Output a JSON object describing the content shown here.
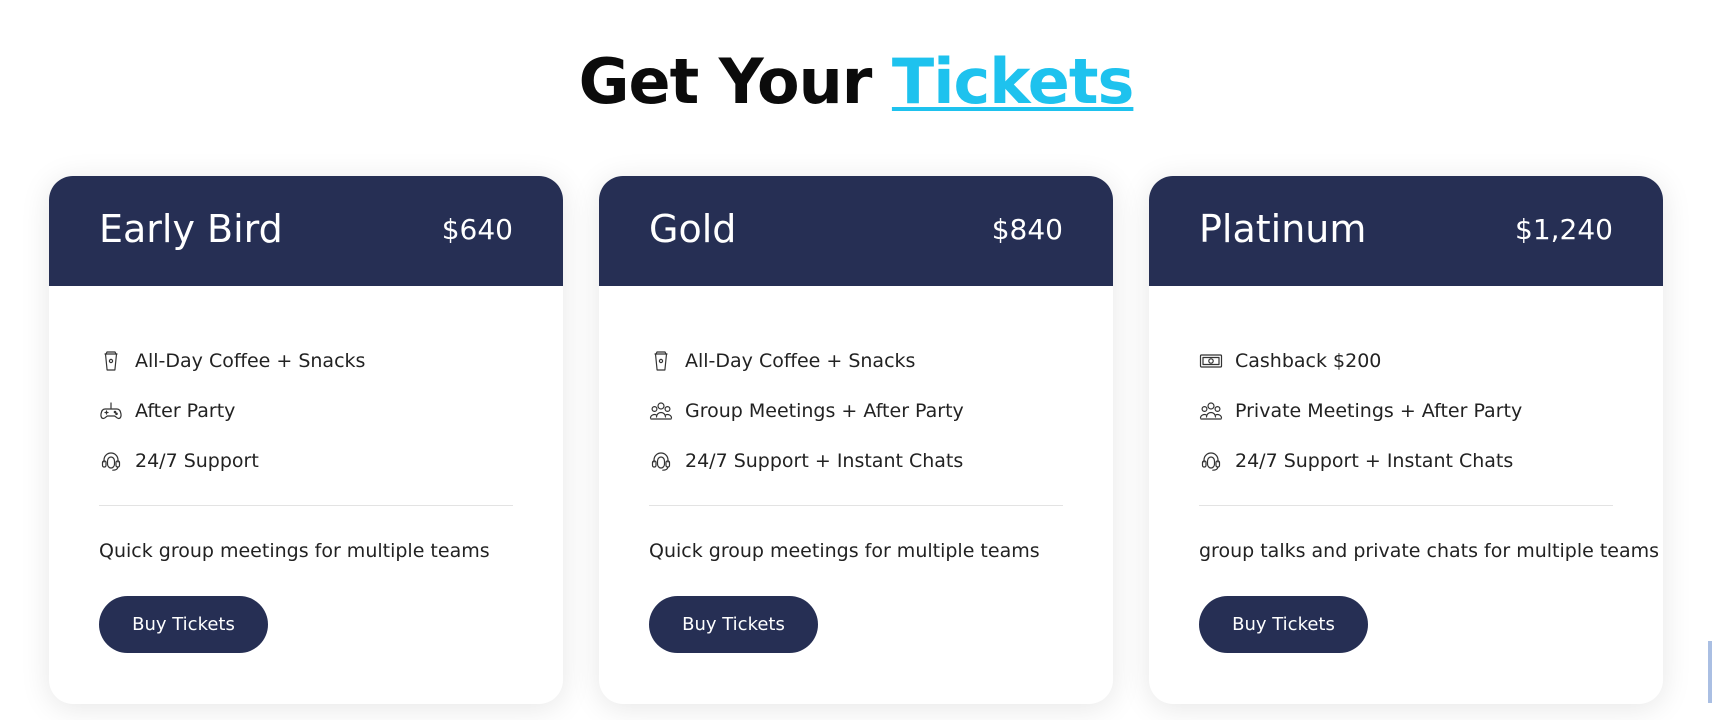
{
  "heading": {
    "prefix": "Get Your",
    "accent": "Tickets",
    "accent_color": "#1ec2ee"
  },
  "colors": {
    "card_header": "#262f54",
    "button": "#262f54"
  },
  "cards": [
    {
      "name": "Early Bird",
      "price": "$640",
      "features": [
        {
          "icon": "coffee-cup-icon",
          "text": "All-Day Coffee + Snacks"
        },
        {
          "icon": "gamepad-icon",
          "text": "After Party"
        },
        {
          "icon": "headset-icon",
          "text": "24/7 Support"
        }
      ],
      "description": "Quick group meetings for multiple teams",
      "button_label": "Buy Tickets"
    },
    {
      "name": "Gold",
      "price": "$840",
      "features": [
        {
          "icon": "coffee-cup-icon",
          "text": "All-Day Coffee + Snacks"
        },
        {
          "icon": "group-meeting-icon",
          "text": "Group Meetings + After Party"
        },
        {
          "icon": "headset-icon",
          "text": "24/7 Support + Instant Chats"
        }
      ],
      "description": "Quick group meetings for multiple teams",
      "button_label": "Buy Tickets"
    },
    {
      "name": "Platinum",
      "price": "$1,240",
      "features": [
        {
          "icon": "cash-icon",
          "text": "Cashback $200"
        },
        {
          "icon": "group-meeting-icon",
          "text": "Private Meetings + After Party"
        },
        {
          "icon": "headset-icon",
          "text": "24/7 Support + Instant Chats"
        }
      ],
      "description": "group talks and private chats for multiple teams",
      "button_label": "Buy Tickets"
    }
  ]
}
